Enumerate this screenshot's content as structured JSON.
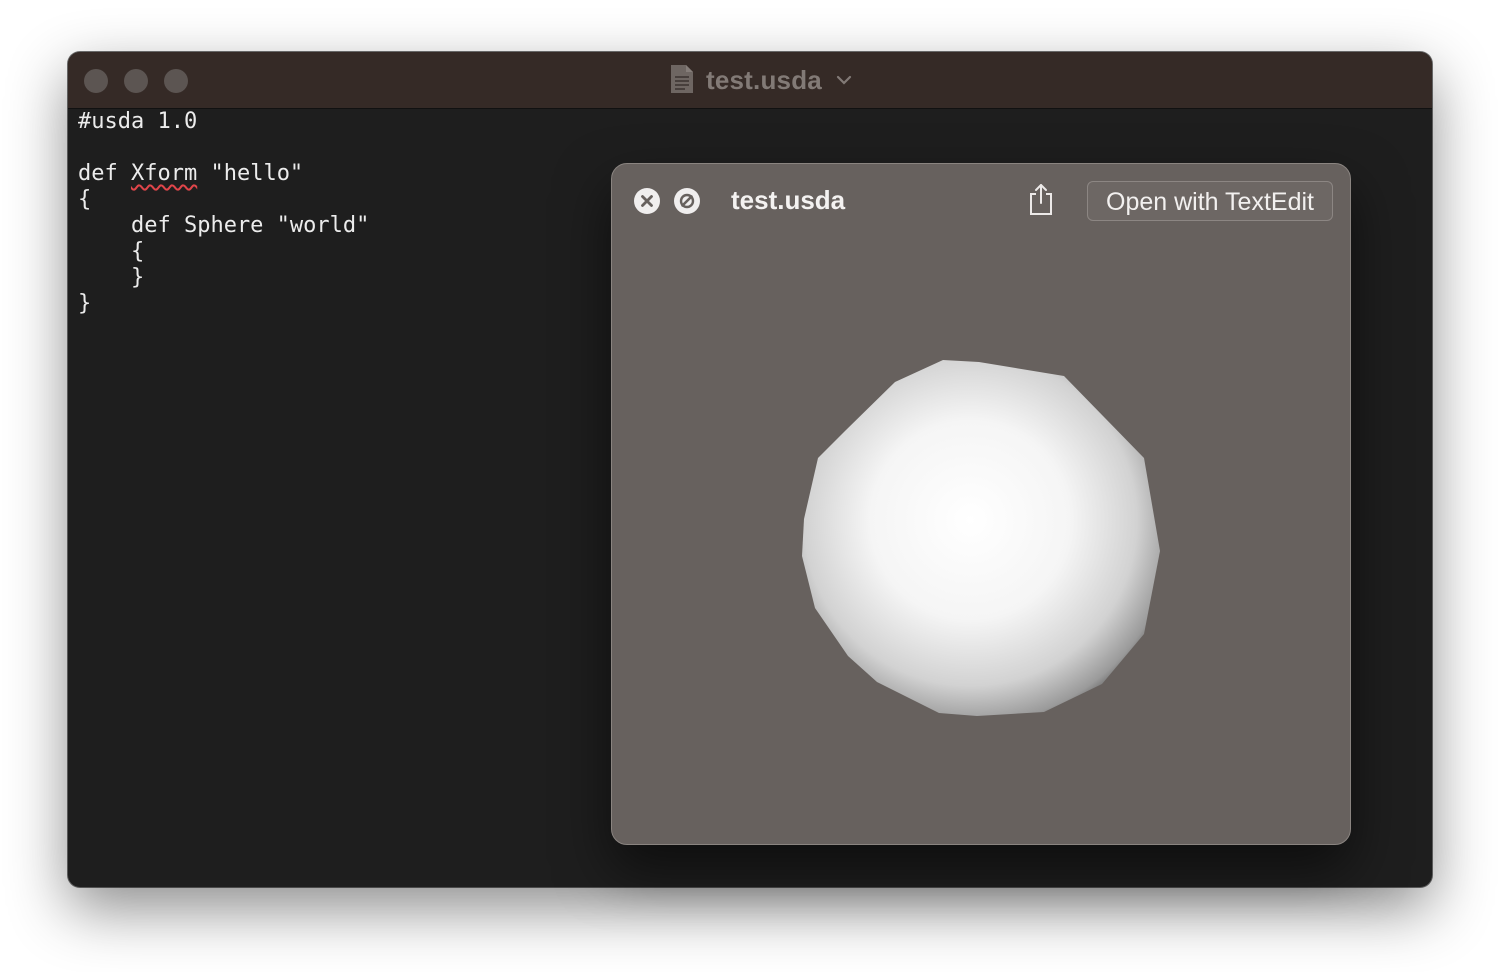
{
  "window": {
    "title": "test.usda",
    "icons": [
      "document-icon",
      "chevron-down-icon"
    ]
  },
  "editor": {
    "lines": [
      "#usda 1.0",
      "",
      "def Xform \"hello\"",
      "{",
      "    def Sphere \"world\"",
      "    {",
      "    }",
      "}"
    ],
    "line3_prefix": "def ",
    "line3_misspelled": "Xform",
    "line3_suffix": " \"hello\""
  },
  "quicklook": {
    "title": "test.usda",
    "open_button_label": "Open with TextEdit",
    "icons": [
      "close-icon",
      "rotate-icon",
      "share-icon"
    ]
  },
  "colors": {
    "editor_background": "#1e1e1e",
    "titlebar": "#352a26",
    "preview_background": "#67615e",
    "text": "#ececec",
    "spelling_underline": "#e0454a"
  }
}
